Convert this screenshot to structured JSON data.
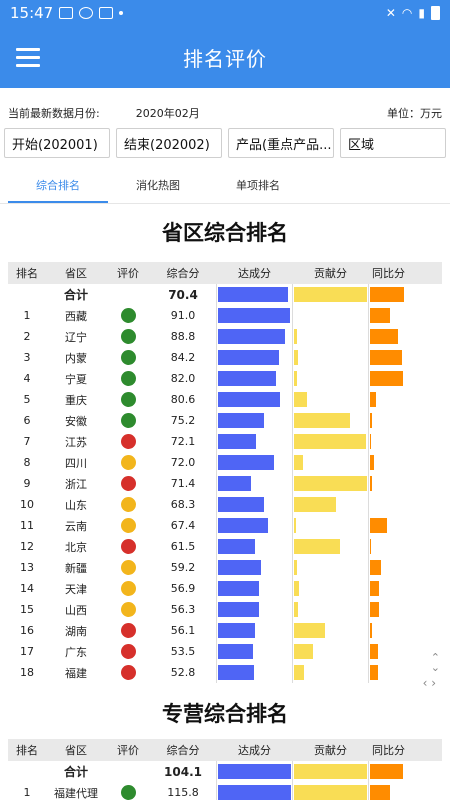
{
  "status": {
    "time": "15:47"
  },
  "app": {
    "title": "排名评价"
  },
  "info": {
    "month_label": "当前最新数据月份:",
    "month_value": "2020年02月",
    "unit": "单位：万元"
  },
  "filters": [
    "开始(202001)",
    "结束(202002)",
    "产品(重点产品...",
    "区域"
  ],
  "tabs": [
    "综合排名",
    "消化热图",
    "单项排名"
  ],
  "colors": {
    "primary": "#3b8bea",
    "green": "#2e8b2e",
    "red": "#d6302b",
    "yellow": "#f2b51c",
    "bar_blue": "#4f65f5",
    "bar_yellow": "#f9dd55",
    "bar_orange": "#ff8c00"
  },
  "headers": [
    "排名",
    "省区",
    "评价",
    "综合分",
    "达成分",
    "贡献分",
    "同比分"
  ],
  "section1": {
    "title": "省区综合排名",
    "total": {
      "label": "合计",
      "score": "70.4",
      "achieve": 0.95,
      "contrib": 0.98,
      "yoy": 0.95
    },
    "rows": [
      {
        "rank": "1",
        "name": "西藏",
        "eval": "green",
        "score": "91.0",
        "achieve": 0.97,
        "contrib": 0.0,
        "yoy": 0.55
      },
      {
        "rank": "2",
        "name": "辽宁",
        "eval": "green",
        "score": "88.8",
        "achieve": 0.9,
        "contrib": 0.04,
        "yoy": 0.78
      },
      {
        "rank": "3",
        "name": "内蒙",
        "eval": "green",
        "score": "84.2",
        "achieve": 0.83,
        "contrib": 0.05,
        "yoy": 0.88
      },
      {
        "rank": "4",
        "name": "宁夏",
        "eval": "green",
        "score": "82.0",
        "achieve": 0.78,
        "contrib": 0.04,
        "yoy": 0.92
      },
      {
        "rank": "5",
        "name": "重庆",
        "eval": "green",
        "score": "80.6",
        "achieve": 0.84,
        "contrib": 0.18,
        "yoy": 0.18
      },
      {
        "rank": "6",
        "name": "安徽",
        "eval": "green",
        "score": "75.2",
        "achieve": 0.62,
        "contrib": 0.75,
        "yoy": 0.05
      },
      {
        "rank": "7",
        "name": "江苏",
        "eval": "red",
        "score": "72.1",
        "achieve": 0.52,
        "contrib": 0.97,
        "yoy": 0.04
      },
      {
        "rank": "8",
        "name": "四川",
        "eval": "yellow",
        "score": "72.0",
        "achieve": 0.75,
        "contrib": 0.12,
        "yoy": 0.12
      },
      {
        "rank": "9",
        "name": "浙江",
        "eval": "red",
        "score": "71.4",
        "achieve": 0.45,
        "contrib": 0.98,
        "yoy": 0.05
      },
      {
        "rank": "10",
        "name": "山东",
        "eval": "yellow",
        "score": "68.3",
        "achieve": 0.62,
        "contrib": 0.57,
        "yoy": 0.0
      },
      {
        "rank": "11",
        "name": "云南",
        "eval": "yellow",
        "score": "67.4",
        "achieve": 0.68,
        "contrib": 0.03,
        "yoy": 0.48
      },
      {
        "rank": "12",
        "name": "北京",
        "eval": "red",
        "score": "61.5",
        "achieve": 0.5,
        "contrib": 0.62,
        "yoy": 0.03
      },
      {
        "rank": "13",
        "name": "新疆",
        "eval": "yellow",
        "score": "59.2",
        "achieve": 0.58,
        "contrib": 0.04,
        "yoy": 0.3
      },
      {
        "rank": "14",
        "name": "天津",
        "eval": "yellow",
        "score": "56.9",
        "achieve": 0.56,
        "contrib": 0.07,
        "yoy": 0.25
      },
      {
        "rank": "15",
        "name": "山西",
        "eval": "yellow",
        "score": "56.3",
        "achieve": 0.55,
        "contrib": 0.06,
        "yoy": 0.26
      },
      {
        "rank": "16",
        "name": "湖南",
        "eval": "red",
        "score": "56.1",
        "achieve": 0.5,
        "contrib": 0.42,
        "yoy": 0.05
      },
      {
        "rank": "17",
        "name": "广东",
        "eval": "red",
        "score": "53.5",
        "achieve": 0.47,
        "contrib": 0.26,
        "yoy": 0.22
      },
      {
        "rank": "18",
        "name": "福建",
        "eval": "red",
        "score": "52.8",
        "achieve": 0.48,
        "contrib": 0.13,
        "yoy": 0.22
      }
    ]
  },
  "section2": {
    "title": "专营综合排名",
    "total": {
      "label": "合计",
      "score": "104.1",
      "achieve": 0.99,
      "contrib": 0.98,
      "yoy": 0.92
    },
    "rows": [
      {
        "rank": "1",
        "name": "福建代理",
        "eval": "green",
        "score": "115.8",
        "achieve": 0.99,
        "contrib": 0.98,
        "yoy": 0.55
      }
    ]
  }
}
